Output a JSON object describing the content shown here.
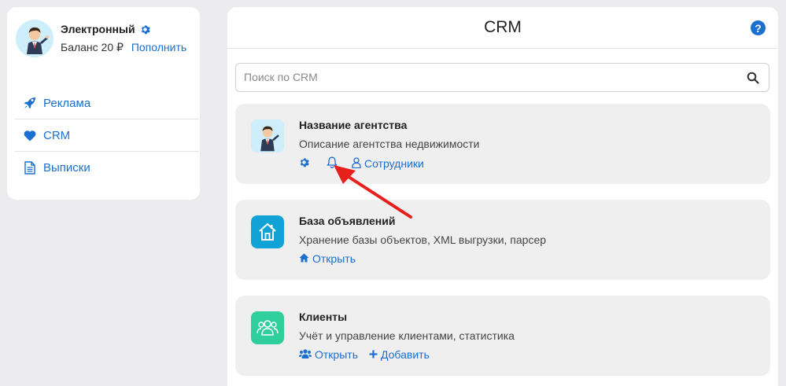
{
  "sidebar": {
    "profile": {
      "name": "Электронный",
      "balance": "Баланс 20 ₽",
      "topup": "Пополнить"
    },
    "items": [
      {
        "label": "Реклама",
        "icon": "rocket-icon"
      },
      {
        "label": "CRM",
        "icon": "heart-icon"
      },
      {
        "label": "Выписки",
        "icon": "document-icon"
      }
    ]
  },
  "main": {
    "title": "CRM",
    "help": "?",
    "search": {
      "placeholder": "Поиск по CRM",
      "value": ""
    },
    "cards": [
      {
        "title": "Название агентства",
        "description": "Описание агентства недвижимости",
        "actions": [
          "Сотрудники"
        ]
      },
      {
        "title": "База объявлений",
        "description": "Хранение базы объектов, XML выгрузки, парсер",
        "actions": [
          "Открыть"
        ]
      },
      {
        "title": "Клиенты",
        "description": "Учёт и управление клиентами, статистика",
        "actions": [
          "Открыть",
          "Добавить"
        ]
      }
    ]
  },
  "colors": {
    "link": "#1a6fd1",
    "accent_blue": "#12a3d6",
    "accent_green": "#2fcf9b",
    "annotation_arrow": "#e8201c"
  }
}
